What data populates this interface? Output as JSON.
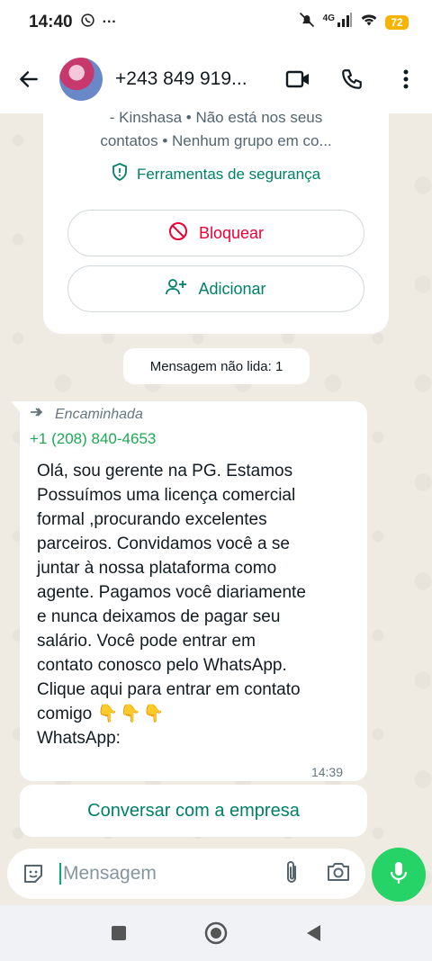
{
  "status_bar": {
    "time": "14:40",
    "more": "···",
    "network": "4G",
    "battery": "72"
  },
  "header": {
    "contact_name": "+243 849 919...",
    "icons": [
      "back-arrow-icon",
      "video-call-icon",
      "phone-icon",
      "more-vertical-icon"
    ]
  },
  "info_card": {
    "line1": "- Kinshasa • Não está nos seus",
    "line2": "contatos • Nenhum grupo em co...",
    "security_label": "Ferramentas de segurança",
    "block_label": "Bloquear",
    "add_label": "Adicionar"
  },
  "unread_label": "Mensagem não lida: 1",
  "message": {
    "forwarded_label": "Encaminhada",
    "sender": "+1 (208) 840-4653",
    "body_lines": [
      "Olá, sou gerente na PG. Estamos",
      "Possuímos uma licença comercial",
      "formal ,procurando excelentes",
      "parceiros.  Convidamos você a se",
      "juntar à nossa plataforma como",
      "agente.  Pagamos você diariamente",
      "e nunca deixamos de pagar seu",
      "salário.  Você pode entrar em",
      "contato conosco pelo WhatsApp.",
      "Clique aqui para entrar em contato",
      "comigo"
    ],
    "emojis": "👇👇👇",
    "last_line": "WhatsApp:",
    "time": "14:39"
  },
  "business_button_label": "Conversar com a empresa",
  "composer": {
    "placeholder": "Mensagem"
  },
  "colors": {
    "accent": "#008069",
    "danger": "#ea0038",
    "mic": "#25d366",
    "chat_bg": "#efeae2"
  }
}
